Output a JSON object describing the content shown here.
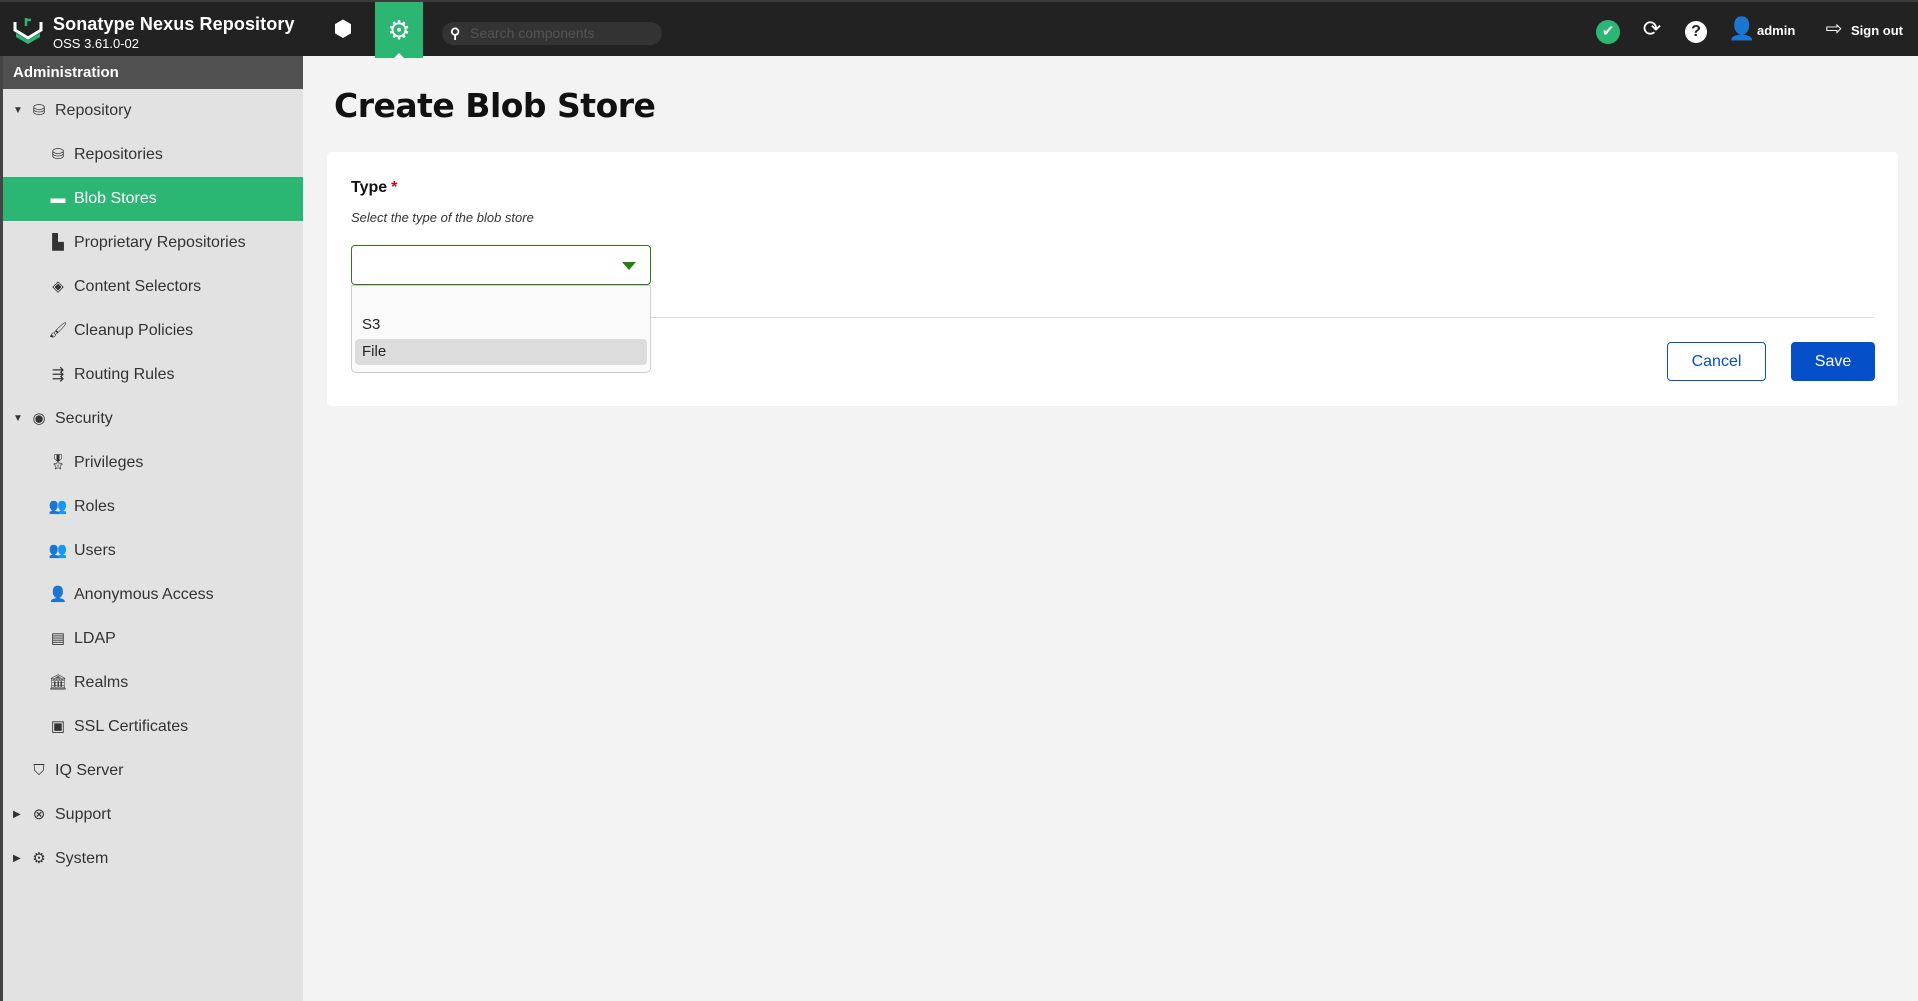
{
  "header": {
    "title": "Sonatype Nexus Repository",
    "version": "OSS 3.61.0-02",
    "search_placeholder": "Search components",
    "user": "admin",
    "sign_out": "Sign out"
  },
  "sidebar": {
    "section": "Administration",
    "items": [
      {
        "label": "Repository",
        "level": 1,
        "caret": "▼",
        "icon": "database-icon",
        "glyph": "⛁"
      },
      {
        "label": "Repositories",
        "level": 2,
        "icon": "database-icon",
        "glyph": "⛁"
      },
      {
        "label": "Blob Stores",
        "level": 2,
        "icon": "hdd-icon",
        "glyph": "▬",
        "selected": true
      },
      {
        "label": "Proprietary Repositories",
        "level": 2,
        "icon": "door-icon",
        "glyph": "▙"
      },
      {
        "label": "Content Selectors",
        "level": 2,
        "icon": "layers-icon",
        "glyph": "◈"
      },
      {
        "label": "Cleanup Policies",
        "level": 2,
        "icon": "broom-icon",
        "glyph": "🖌"
      },
      {
        "label": "Routing Rules",
        "level": 2,
        "icon": "signpost-icon",
        "glyph": "⇶"
      },
      {
        "label": "Security",
        "level": 1,
        "caret": "▼",
        "icon": "badge-icon",
        "glyph": "◉"
      },
      {
        "label": "Privileges",
        "level": 2,
        "icon": "medal-icon",
        "glyph": "🎖"
      },
      {
        "label": "Roles",
        "level": 2,
        "icon": "users-icon",
        "glyph": "👥"
      },
      {
        "label": "Users",
        "level": 2,
        "icon": "group-icon",
        "glyph": "👥"
      },
      {
        "label": "Anonymous Access",
        "level": 2,
        "icon": "user-icon",
        "glyph": "👤"
      },
      {
        "label": "LDAP",
        "level": 2,
        "icon": "book-icon",
        "glyph": "▤"
      },
      {
        "label": "Realms",
        "level": 2,
        "icon": "building-icon",
        "glyph": "🏛"
      },
      {
        "label": "SSL Certificates",
        "level": 2,
        "icon": "id-card-icon",
        "glyph": "▣"
      },
      {
        "label": "IQ Server",
        "level": 1,
        "icon": "shield-icon",
        "glyph": "⛉"
      },
      {
        "label": "Support",
        "level": 1,
        "caret": "▶",
        "icon": "lifebuoy-icon",
        "glyph": "⊗"
      },
      {
        "label": "System",
        "level": 1,
        "caret": "▶",
        "icon": "gear-icon",
        "glyph": "⚙"
      }
    ]
  },
  "page": {
    "title": "Create Blob Store",
    "type_label": "Type",
    "required_mark": "*",
    "type_help": "Select the type of the blob store",
    "options": [
      "",
      "S3",
      "File"
    ],
    "highlighted_option": "File",
    "cancel": "Cancel",
    "save": "Save"
  },
  "colors": {
    "accent": "#2bb673",
    "primary": "#0550c8"
  }
}
